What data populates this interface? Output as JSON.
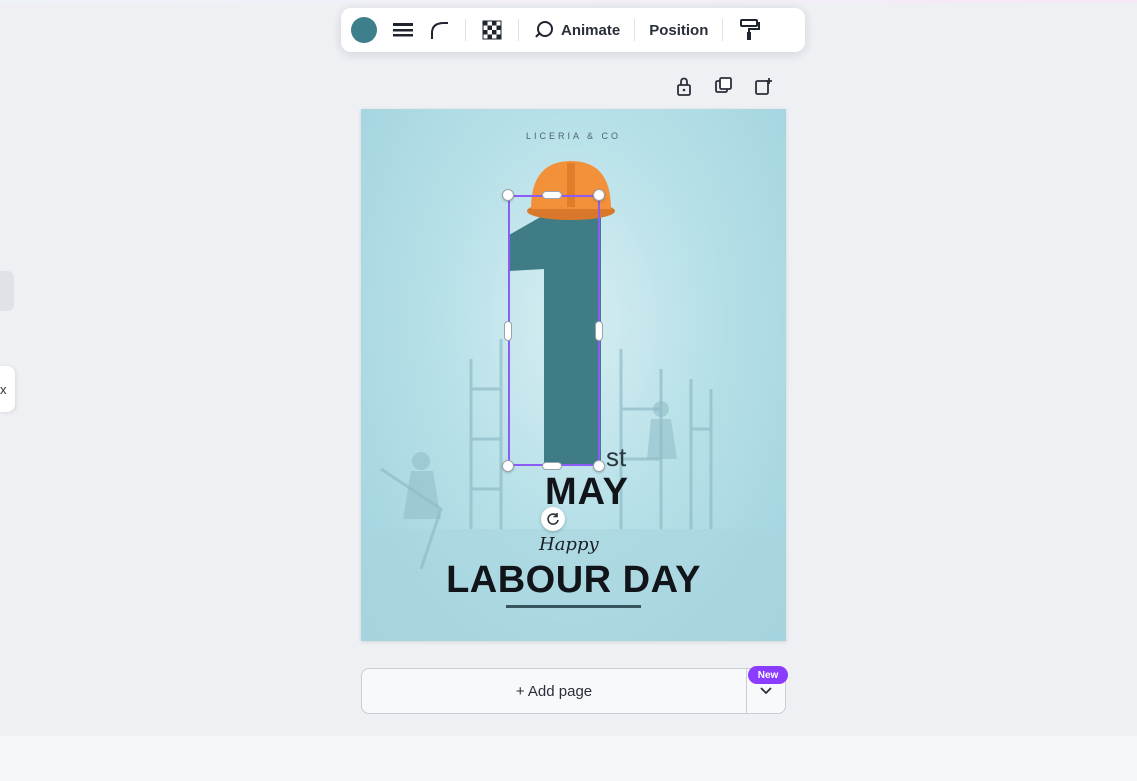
{
  "toolbar": {
    "color_swatch": "#3d7f8a",
    "border_style_icon": "lines-icon",
    "corner_rounding_icon": "corner-radius-icon",
    "transparency_icon": "checker-icon",
    "animate_label": "Animate",
    "position_label": "Position",
    "copy_style_icon": "paint-roller-icon"
  },
  "page_actions": [
    "lock-icon",
    "duplicate-icon",
    "add-page-share-icon"
  ],
  "design": {
    "brand": "LICERIA & CO",
    "ordinal_suffix": "st",
    "month": "MAY",
    "script_word": "Happy",
    "headline": "LABOUR DAY",
    "numeral_color": "#3f7c86",
    "helmet_color": "#f2913a",
    "background_color": "#b7e0e8"
  },
  "add_page": {
    "label": "+ Add page",
    "badge": "New"
  },
  "left_panel": {
    "close_glyph": "x"
  },
  "accent_color": "#8b5cf6"
}
